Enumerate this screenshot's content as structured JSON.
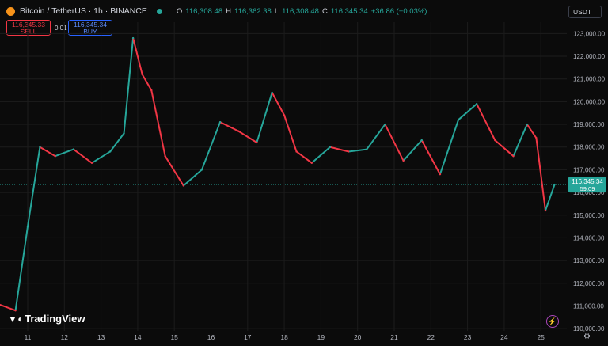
{
  "header": {
    "title": "Bitcoin / TetherUS · 1h · BINANCE",
    "ohlc": [
      {
        "label": "O",
        "value": "116,308.48"
      },
      {
        "label": "H",
        "value": "116,362.38"
      },
      {
        "label": "L",
        "value": "116,308.48"
      },
      {
        "label": "C",
        "value": "116,345.34"
      },
      {
        "label": "",
        "value": "+36.86 (+0.03%)"
      }
    ],
    "unit": "USDT"
  },
  "trade": {
    "sell_price": "116,345.33",
    "sell_label": "SELL",
    "spread": "0.01",
    "buy_price": "116,345.34",
    "buy_label": "BUY"
  },
  "price_label": {
    "price": "116,345.34",
    "countdown": "59:09"
  },
  "brand": "TradingView",
  "colors": {
    "up": "#26a69a",
    "down": "#f23645",
    "bg": "#0b0b0b",
    "grid": "#1c1c1c",
    "axis_text": "#b2b5be"
  },
  "icons": [
    "bitcoin-icon",
    "lightning-icon",
    "settings-icon"
  ],
  "chart_data": {
    "type": "line",
    "title": "Bitcoin / TetherUS · 1h · BINANCE",
    "xlabel": "",
    "ylabel": "",
    "x": [
      "10",
      "11",
      "11",
      "11",
      "12",
      "12",
      "13",
      "13",
      "14",
      "14",
      "14",
      "14",
      "15",
      "15",
      "16",
      "16",
      "17",
      "17",
      "18",
      "18",
      "18",
      "19",
      "19",
      "20",
      "20",
      "21",
      "21",
      "22",
      "22",
      "23",
      "23",
      "24",
      "24",
      "25",
      "25",
      "25",
      "25"
    ],
    "series": [
      {
        "values": [
          111200,
          110800,
          114500,
          118000,
          117600,
          117900,
          117300,
          117800,
          118600,
          122800,
          121200,
          120500,
          117600,
          116300,
          117000,
          119100,
          118700,
          118200,
          120400,
          119400,
          117800,
          117300,
          118000,
          117800,
          117900,
          119000,
          117400,
          118300,
          116800,
          119200,
          119900,
          118300,
          117600,
          119000,
          118400,
          115200,
          116350
        ]
      }
    ],
    "x_ticks": [
      "11",
      "12",
      "13",
      "14",
      "15",
      "16",
      "17",
      "18",
      "19",
      "20",
      "21",
      "22",
      "23",
      "24",
      "25"
    ],
    "y_ticks": [
      "123,000.00",
      "122,000.00",
      "121,000.00",
      "120,000.00",
      "119,000.00",
      "118,000.00",
      "117,000.00",
      "116,000.00",
      "115,000.00",
      "114,000.00",
      "113,000.00",
      "112,000.00",
      "111,000.00",
      "110,000.00"
    ],
    "ylim": [
      109900,
      123500
    ],
    "last_price": 116345.34,
    "grid": true
  }
}
